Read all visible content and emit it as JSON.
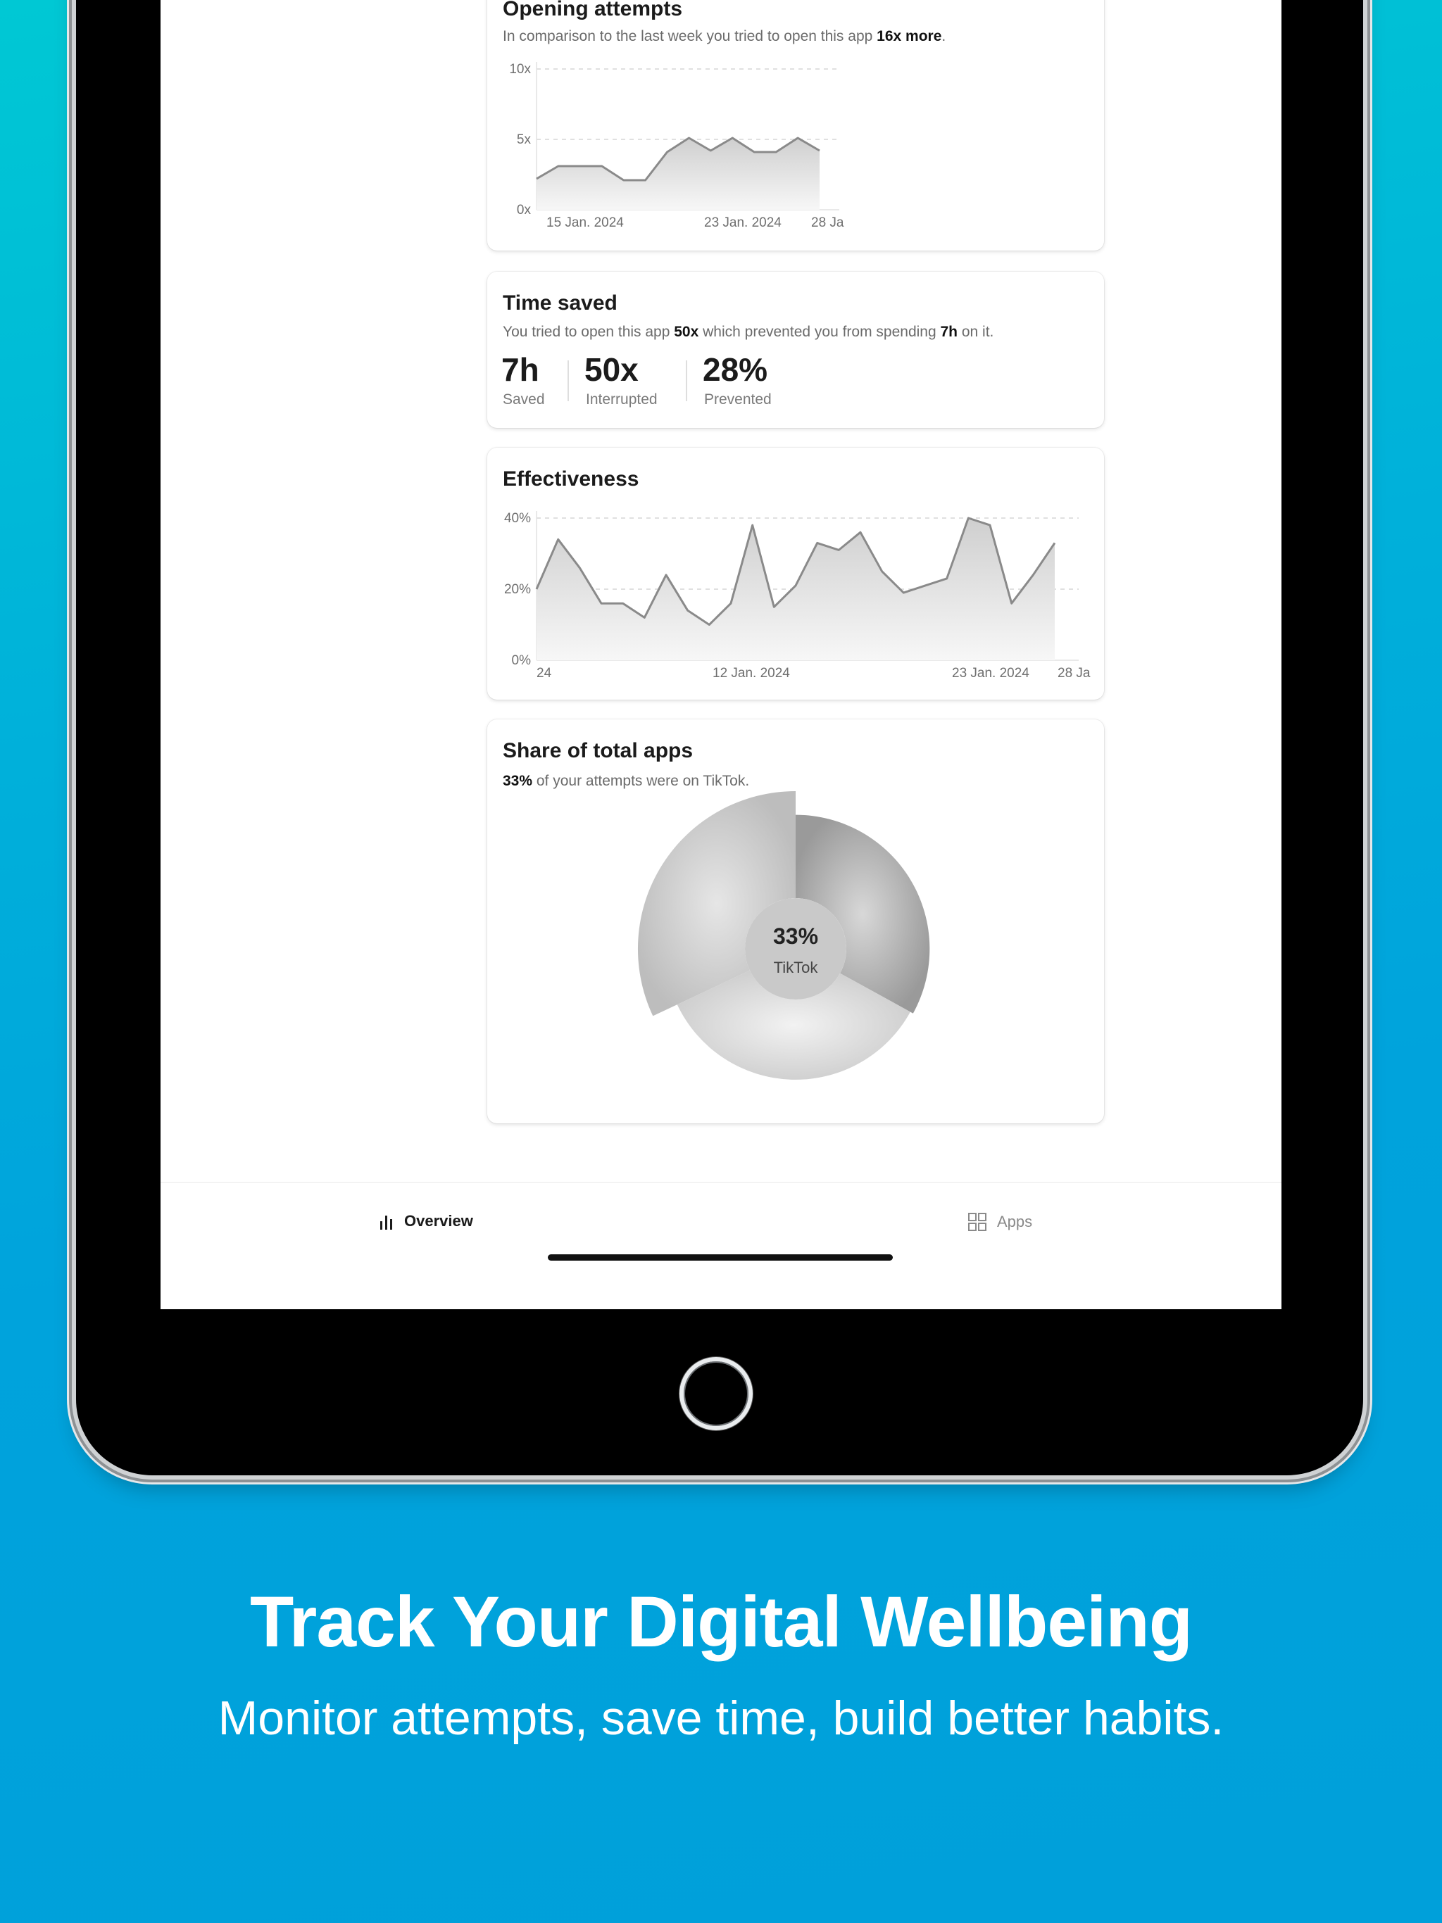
{
  "opening_attempts": {
    "title": "Opening attempts",
    "subtitle_prefix": "In comparison to the last week you tried to open this app ",
    "subtitle_bold": "16x more",
    "subtitle_suffix": ".",
    "chart_data": {
      "type": "area",
      "y_ticks": [
        "10x",
        "5x",
        "0x"
      ],
      "ylim": [
        0,
        10
      ],
      "x_tick_labels": [
        "15 Jan. 2024",
        "23 Jan. 2024",
        "28 Ja"
      ],
      "values": [
        2.2,
        3.1,
        3.1,
        3.1,
        2.1,
        2.1,
        4.1,
        5.1,
        4.2,
        5.1,
        4.1,
        4.1,
        5.1,
        4.2
      ],
      "grid": "dashed horizontal"
    }
  },
  "time_saved": {
    "title": "Time saved",
    "subtitle_parts": [
      "You tried to open this app ",
      "50x",
      " which prevented you from spending ",
      "7h",
      " on it."
    ],
    "stats": [
      {
        "value": "7h",
        "label": "Saved"
      },
      {
        "value": "50x",
        "label": "Interrupted"
      },
      {
        "value": "28%",
        "label": "Prevented"
      }
    ]
  },
  "effectiveness": {
    "title": "Effectiveness",
    "chart_data": {
      "type": "area",
      "y_ticks": [
        "40%",
        "20%",
        "0%"
      ],
      "ylim": [
        0,
        40
      ],
      "x_tick_labels": [
        "24",
        "12 Jan. 2024",
        "23 Jan. 2024",
        "28 Ja"
      ],
      "values": [
        20,
        34,
        26,
        16,
        16,
        12,
        24,
        14,
        10,
        16,
        38,
        15,
        21,
        33,
        31,
        36,
        25,
        19,
        21,
        23,
        40,
        38,
        16,
        24,
        33
      ],
      "grid": "dashed horizontal"
    }
  },
  "share": {
    "title": "Share of total apps",
    "subtitle_bold": "33%",
    "subtitle_rest": " of your attempts were on TikTok.",
    "center_value": "33%",
    "center_label": "TikTok",
    "chart_data": {
      "type": "pie",
      "style": "rose / polar area with inner hole",
      "slices": [
        {
          "share": 33,
          "radius_rel": 0.85
        },
        {
          "share": 35,
          "radius_rel": 0.83
        },
        {
          "share": 32,
          "radius_rel": 1.0
        }
      ],
      "colors": [
        "#a6a6a6",
        "#d8d8d8",
        "#c4c4c4"
      ]
    }
  },
  "tabbar": {
    "overview_label": "Overview",
    "apps_label": "Apps"
  },
  "marketing": {
    "headline": "Track Your Digital Wellbeing",
    "subline": "Monitor attempts, save time, build better habits."
  },
  "colors": {
    "background_top": "#00c8d4",
    "background_bottom": "#00a0da",
    "chart_line": "#8a8a8a"
  }
}
